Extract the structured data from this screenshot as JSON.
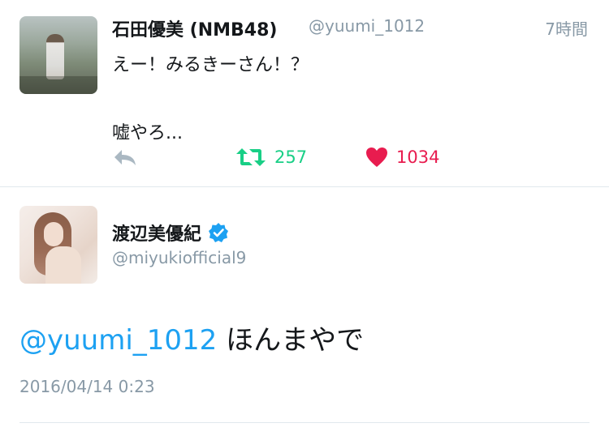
{
  "tweet": {
    "author_name": "石田優美 (NMB48)",
    "author_handle": "@yuumi_1012",
    "timestamp": "7時間",
    "text_line1": "えー！みるきーさん！？",
    "text_line2": "嘘やろ...",
    "retweet_count": "257",
    "like_count": "1034",
    "colors": {
      "retweet": "#19cf86",
      "like": "#e81c4f",
      "muted": "#8899a6"
    }
  },
  "reply": {
    "author_name": "渡辺美優紀",
    "author_handle": "@miyukiofficial9",
    "verified": true,
    "mention": "@yuumi_1012",
    "text": " ほんまやで",
    "date": "2016/04/14 0:23",
    "colors": {
      "mention": "#1da1f2",
      "verified": "#1da1f2"
    }
  },
  "icons": {
    "reply": "reply-icon",
    "retweet": "retweet-icon",
    "like": "heart-icon",
    "verified": "verified-badge-icon"
  }
}
